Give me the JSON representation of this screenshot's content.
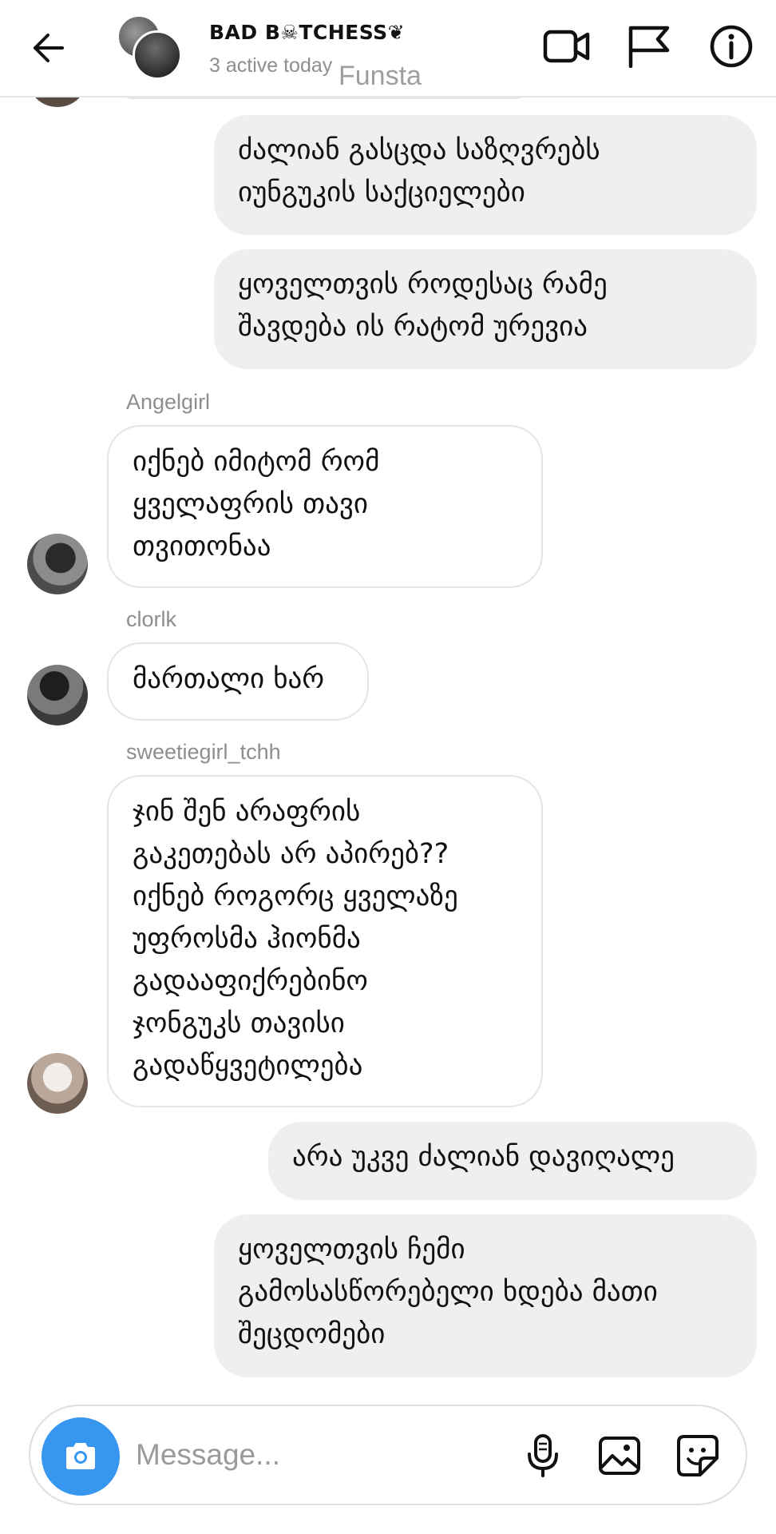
{
  "header": {
    "group_name": "BAD B☠TCHESS❦",
    "status": "3 active today",
    "watermark": "Funsta",
    "icons": [
      "back-arrow-icon",
      "video-camera-icon",
      "flag-icon",
      "info-icon"
    ]
  },
  "messages": [
    {
      "type": "sent",
      "text": "ძალიან გასცდა საზღვრებს\nიუნგუკის საქციელები"
    },
    {
      "type": "sent",
      "text": "ყოველთვის როდესაც რამე\nშავდება ის რატომ ურევია"
    },
    {
      "type": "received",
      "sender": "Angelgirl",
      "text": "იქნებ იმიტომ რომ\nყველაფრის თავი\nთვითონაა"
    },
    {
      "type": "received",
      "sender": "clorlk",
      "text": "მართალი ხარ"
    },
    {
      "type": "received",
      "sender": "sweetiegirl_tchh",
      "text": "ჯინ შენ არაფრის\nგაკეთებას არ აპირებ??\nიქნებ როგორც ყველაზე\nუფროსმა ჰიონმა\nგადააფიქრებინო\nჯონგუკს თავისი\nგადაწყვეტილება"
    },
    {
      "type": "sent",
      "text": "არა უკვე ძალიან დავიღალე"
    },
    {
      "type": "sent",
      "text": "ყოველთვის ჩემი\nგამოსასწორებელი ხდება მათი\nშეცდომები"
    }
  ],
  "composer": {
    "placeholder": "Message...",
    "icons": [
      "camera-icon",
      "microphone-icon",
      "gallery-icon",
      "sticker-icon"
    ]
  },
  "colors": {
    "accent": "#3797f0",
    "sent_bubble": "#efefef",
    "muted_text": "#8e8e8e"
  }
}
